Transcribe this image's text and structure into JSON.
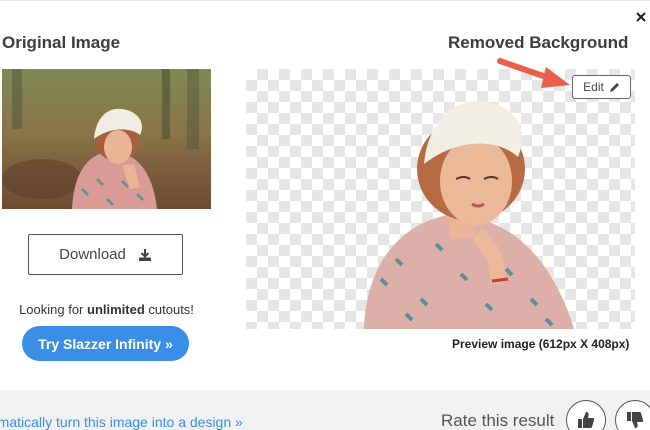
{
  "header": {
    "close_icon": "close-icon"
  },
  "original": {
    "title": "Original Image",
    "download_label": "Download",
    "download_icon": "download-icon",
    "promo_prefix": "Looking for ",
    "promo_bold": "unlimited",
    "promo_suffix": " cutouts!",
    "try_label": "Try Slazzer Infinity",
    "try_chevron": "»"
  },
  "result": {
    "title": "Removed Background",
    "edit_label": "Edit",
    "edit_icon": "pencil-icon",
    "preview_caption": "Preview image (612px X 408px)"
  },
  "footer": {
    "design_link": "tomatically turn this image into a design",
    "design_chevron": "»",
    "rate_label": "Rate this result",
    "thumbs_up_icon": "thumbs-up-icon",
    "thumbs_down_icon": "thumbs-down-icon"
  },
  "colors": {
    "accent": "#3a8ee6",
    "arrow": "#e8604c",
    "footer_bg": "#f1f1f1"
  }
}
